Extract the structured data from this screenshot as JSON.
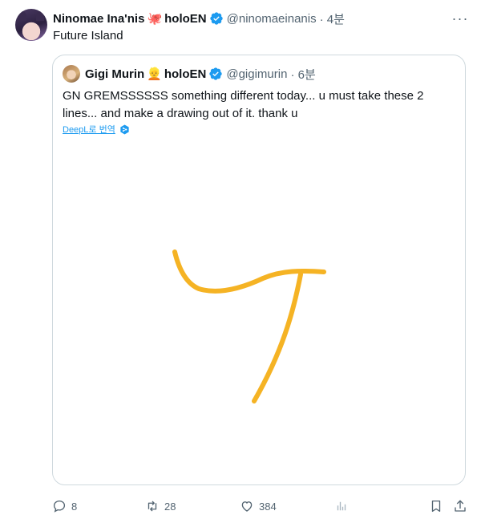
{
  "tweet": {
    "author_name": "Ninomae Ina'nis",
    "author_emoji": "🐙",
    "author_suffix": "holoEN",
    "handle": "@ninomaeinanis",
    "time": "· 4분",
    "more_label": "···",
    "text": "Future Island"
  },
  "quoted": {
    "author_name": "Gigi Murin",
    "author_emoji": "👱",
    "author_suffix": "holoEN",
    "handle": "@gigimurin",
    "time": "· 6분",
    "text": "GN GREMSSSSSS something different today... u must take these 2 lines... and make a drawing out of it. thank u",
    "translate_label": "DeepL로 번역"
  },
  "actions": {
    "replies": "8",
    "retweets": "28",
    "likes": "384"
  },
  "colors": {
    "accent": "#1d9bf0",
    "drawing_stroke": "#f5b324",
    "muted": "#536471"
  }
}
